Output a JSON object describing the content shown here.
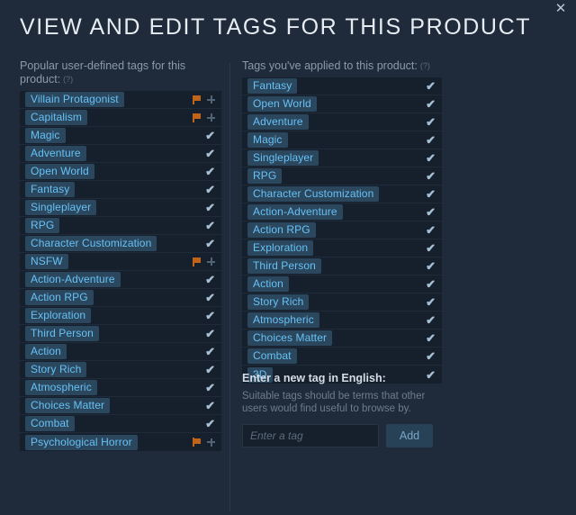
{
  "dialog": {
    "title": "VIEW AND EDIT TAGS FOR THIS PRODUCT",
    "close_label": "✕"
  },
  "left_column": {
    "header": "Popular user-defined tags for this product:",
    "hint": "(?)",
    "tags": [
      {
        "label": "Villain Protagonist",
        "applied": false
      },
      {
        "label": "Capitalism",
        "applied": false
      },
      {
        "label": "Magic",
        "applied": true
      },
      {
        "label": "Adventure",
        "applied": true
      },
      {
        "label": "Open World",
        "applied": true
      },
      {
        "label": "Fantasy",
        "applied": true
      },
      {
        "label": "Singleplayer",
        "applied": true
      },
      {
        "label": "RPG",
        "applied": true
      },
      {
        "label": "Character Customization",
        "applied": true
      },
      {
        "label": "NSFW",
        "applied": false
      },
      {
        "label": "Action-Adventure",
        "applied": true
      },
      {
        "label": "Action RPG",
        "applied": true
      },
      {
        "label": "Exploration",
        "applied": true
      },
      {
        "label": "Third Person",
        "applied": true
      },
      {
        "label": "Action",
        "applied": true
      },
      {
        "label": "Story Rich",
        "applied": true
      },
      {
        "label": "Atmospheric",
        "applied": true
      },
      {
        "label": "Choices Matter",
        "applied": true
      },
      {
        "label": "Combat",
        "applied": true
      },
      {
        "label": "Psychological Horror",
        "applied": false
      }
    ]
  },
  "right_column": {
    "header": "Tags you've applied to this product:",
    "hint": "(?)",
    "tags": [
      {
        "label": "Fantasy",
        "applied": true
      },
      {
        "label": "Open World",
        "applied": true
      },
      {
        "label": "Adventure",
        "applied": true
      },
      {
        "label": "Magic",
        "applied": true
      },
      {
        "label": "Singleplayer",
        "applied": true
      },
      {
        "label": "RPG",
        "applied": true
      },
      {
        "label": "Character Customization",
        "applied": true
      },
      {
        "label": "Action-Adventure",
        "applied": true
      },
      {
        "label": "Action RPG",
        "applied": true
      },
      {
        "label": "Exploration",
        "applied": true
      },
      {
        "label": "Third Person",
        "applied": true
      },
      {
        "label": "Action",
        "applied": true
      },
      {
        "label": "Story Rich",
        "applied": true
      },
      {
        "label": "Atmospheric",
        "applied": true
      },
      {
        "label": "Choices Matter",
        "applied": true
      },
      {
        "label": "Combat",
        "applied": true
      },
      {
        "label": "3D",
        "applied": true
      }
    ]
  },
  "new_tag": {
    "label": "Enter a new tag in English:",
    "help": "Suitable tags should be terms that other users would find useful to browse by.",
    "input_placeholder": "Enter a tag",
    "input_value": "",
    "add_label": "Add"
  },
  "icons": {
    "check": "✔",
    "flag": "flag-icon",
    "plus": "plus-icon"
  },
  "colors": {
    "modal_bg": "#1f2b3a",
    "row_bg": "#16202d",
    "pill_bg": "#2a475e",
    "pill_text": "#67c1f5",
    "check": "#a7c0d4",
    "flag": "#c0641a",
    "add_btn_bg": "#274257",
    "add_btn_text": "#78a5c4"
  }
}
